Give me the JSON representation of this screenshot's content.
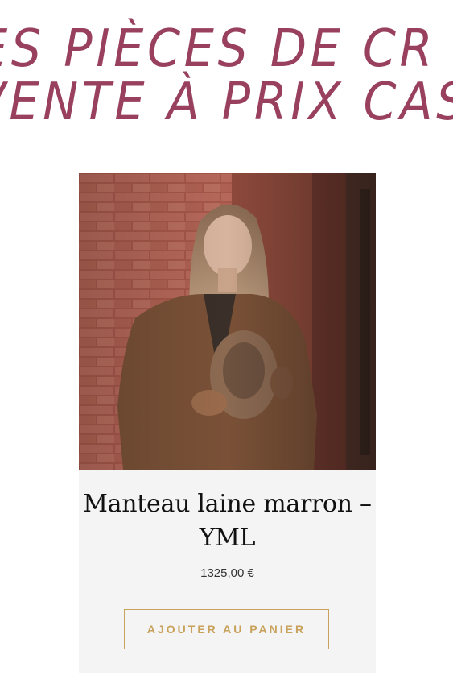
{
  "banner": {
    "line1": "ES PIÈCES DE CR",
    "line2": "VENTE À PRIX CAS"
  },
  "product": {
    "image_alt": "Femme portant un manteau en laine marron tenant un chapeau",
    "title": "Manteau laine marron – YML",
    "price": "1325,00 €",
    "add_to_cart_label": "AJOUTER AU PANIER"
  },
  "colors": {
    "headline": "#98405e",
    "button_accent": "#c8a15a",
    "card_background": "#f4f4f4"
  }
}
